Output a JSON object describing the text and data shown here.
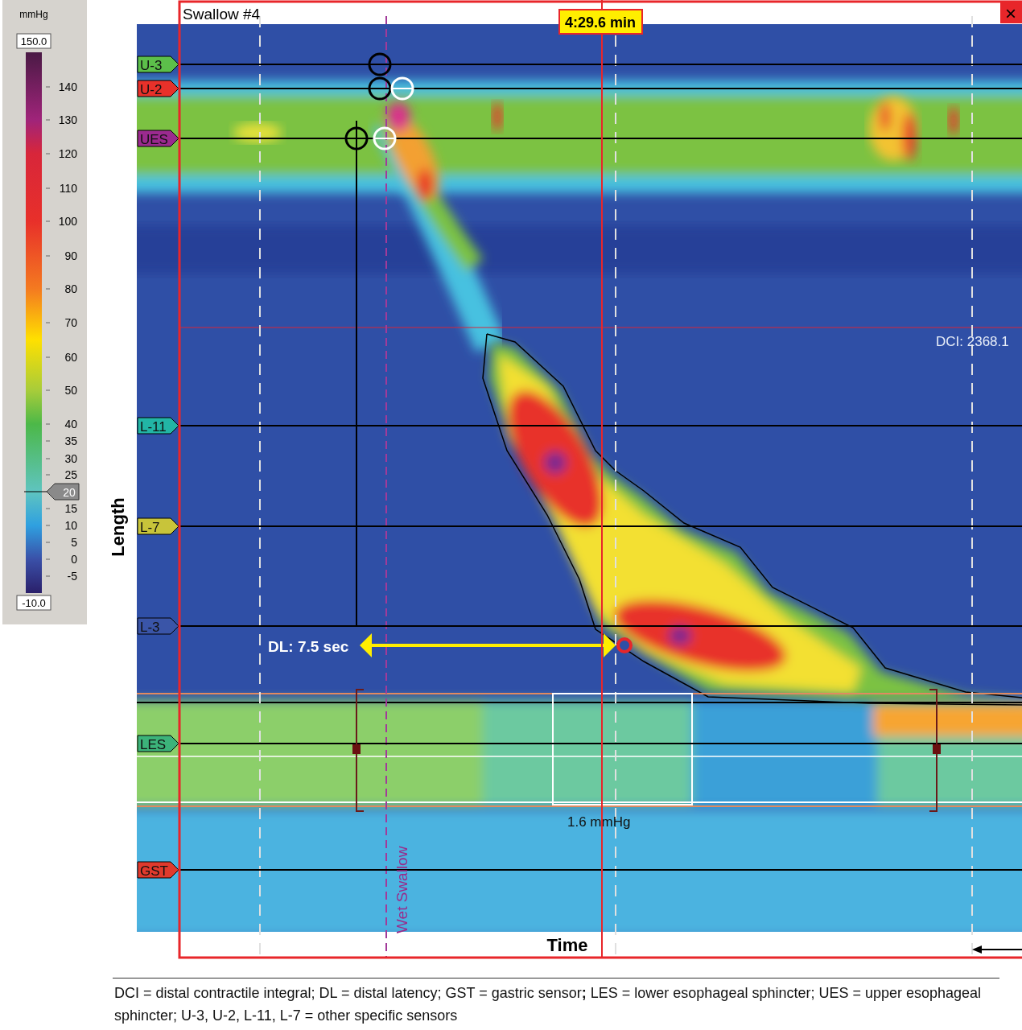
{
  "colorbar": {
    "unit": "mmHg",
    "max": "150.0",
    "min": "-10.0",
    "ticks": [
      "140",
      "130",
      "120",
      "110",
      "100",
      "90",
      "80",
      "70",
      "60",
      "50",
      "40",
      "35",
      "30",
      "25",
      "15",
      "10",
      "5",
      "0",
      "-5"
    ],
    "marker": "20"
  },
  "plot": {
    "title": "Swallow #4",
    "time_cursor": "4:29.6 min",
    "dci": "DCI: 2368.1",
    "dl": "DL: 7.5 sec",
    "les_pressure": "1.6 mmHg",
    "event": "Wet Swallow",
    "x_axis": "Time",
    "y_axis": "Length",
    "close": "×"
  },
  "sensors": [
    {
      "label": "U-3",
      "color": "#5cbf4a"
    },
    {
      "label": "U-2",
      "color": "#e8312a"
    },
    {
      "label": "UES",
      "color": "#9b2a8f"
    },
    {
      "label": "L-11",
      "color": "#22b5a5"
    },
    {
      "label": "L-7",
      "color": "#c8c43a"
    },
    {
      "label": "L-3",
      "color": "#3a55a8"
    },
    {
      "label": "LES",
      "color": "#3cb37a"
    },
    {
      "label": "GST",
      "color": "#e03a2d"
    }
  ],
  "caption": "DCI = distal contractile integral; DL = distal latency; GST =  gastric sensor**;** LES = lower esophageal sphincter; UES = upper esophageal sphincter; U-3, U-2, L-11, L-7 = other specific sensors"
}
